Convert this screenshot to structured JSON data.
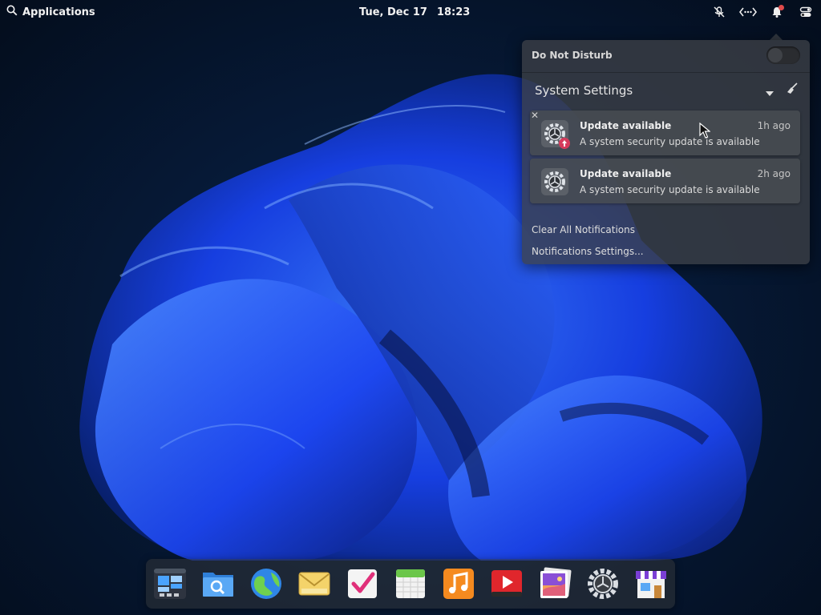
{
  "top_panel": {
    "applications_label": "Applications",
    "date": "Tue, Dec 17",
    "time": "18:23",
    "indicators": [
      "microphone-muted-icon",
      "network-wired-icon",
      "notifications-icon",
      "system-toggle-icon"
    ]
  },
  "notifications": {
    "dnd_label": "Do Not Disturb",
    "dnd_enabled": false,
    "app_group": "System Settings",
    "items": [
      {
        "title": "Update available",
        "time": "1h ago",
        "body": "A system security update is available"
      },
      {
        "title": "Update available",
        "time": "2h ago",
        "body": "A system security update is available"
      }
    ],
    "close_glyph": "✕",
    "clear_all_label": "Clear All Notifications",
    "settings_label": "Notifications Settings..."
  },
  "dock": {
    "apps": [
      "multitasking-view-icon",
      "files-icon",
      "web-browser-icon",
      "mail-icon",
      "tasks-icon",
      "calendar-icon",
      "music-icon",
      "videos-icon",
      "photos-icon",
      "system-settings-icon",
      "appcenter-icon"
    ]
  },
  "colors": {
    "notification_badge": "#e04a4a",
    "wallpaper_accent": "#1a4cff"
  }
}
